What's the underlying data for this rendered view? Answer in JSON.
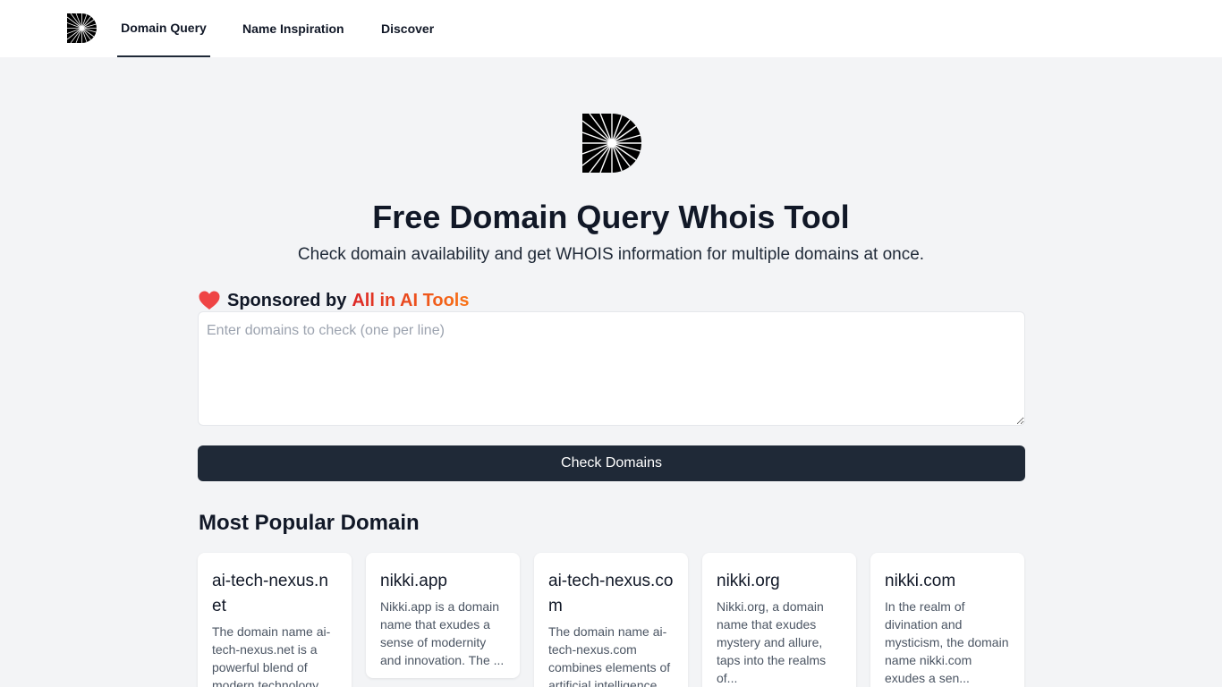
{
  "nav": {
    "items": [
      {
        "label": "Domain Query",
        "active": true
      },
      {
        "label": "Name Inspiration",
        "active": false
      },
      {
        "label": "Discover",
        "active": false
      }
    ]
  },
  "hero": {
    "title": "Free Domain Query Whois Tool",
    "subtitle": "Check domain availability and get WHOIS information for multiple domains at once."
  },
  "sponsor": {
    "icon": "heart-icon",
    "prefix": "Sponsored by",
    "link": "All in AI Tools"
  },
  "search": {
    "placeholder": "Enter domains to check (one per line)",
    "value": ""
  },
  "check_button": {
    "label": "Check Domains"
  },
  "popular": {
    "title": "Most Popular Domain",
    "cards": [
      {
        "domain": "ai-tech-nexus.net",
        "description": "The domain name ai-tech-nexus.net is a powerful blend of modern technology"
      },
      {
        "domain": "nikki.app",
        "description": "Nikki.app is a domain name that exudes a sense of modernity and innovation. The ..."
      },
      {
        "domain": "ai-tech-nexus.com",
        "description": "The domain name ai-tech-nexus.com combines elements of artificial intelligence"
      },
      {
        "domain": "nikki.org",
        "description": "Nikki.org, a domain name that exudes mystery and allure, taps into the realms of..."
      },
      {
        "domain": "nikki.com",
        "description": "In the realm of divination and mysticism, the domain name nikki.com exudes a sen..."
      }
    ]
  },
  "colors": {
    "primary": "#1f2937",
    "background": "#f3f4f6",
    "sponsor_gradient_start": "#dc2626",
    "sponsor_gradient_end": "#f97316"
  }
}
